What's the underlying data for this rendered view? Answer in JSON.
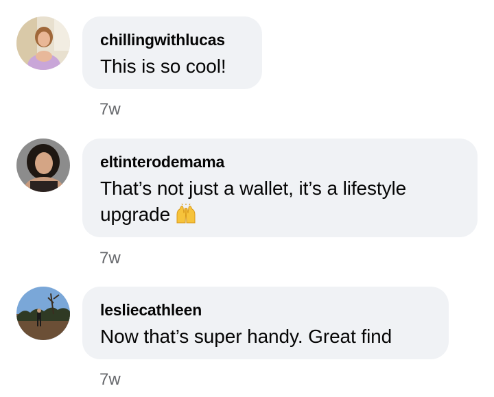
{
  "comments": [
    {
      "username": "chillingwithlucas",
      "text": "This is so cool!",
      "time": "7w",
      "avatar": "woman-pink-dress-avatar"
    },
    {
      "username": "eltinterodemama",
      "text_line1": "That’s not just a wallet, it’s a lifestyle",
      "text_line2": "upgrade",
      "emoji": "raising-hands-emoji",
      "time": "7w",
      "avatar": "woman-dark-hair-avatar"
    },
    {
      "username": "lesliecathleen",
      "text": "Now that’s super handy. Great find",
      "time": "7w",
      "avatar": "outdoor-hiker-avatar"
    }
  ],
  "colors": {
    "bubble": "#f0f2f5",
    "timestamp": "#65676b",
    "text": "#050505"
  }
}
